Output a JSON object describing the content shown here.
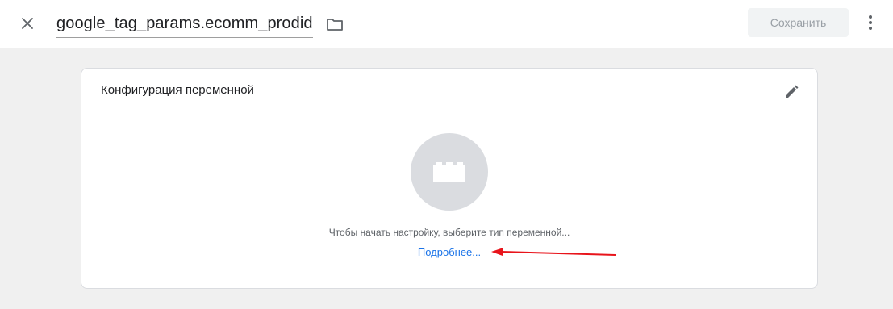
{
  "header": {
    "title": "google_tag_params.ecomm_prodid",
    "save_label": "Сохранить",
    "close_icon": "close-icon",
    "folder_icon": "folder-icon",
    "more_icon": "more-vert-icon"
  },
  "card": {
    "title": "Конфигурация переменной",
    "edit_icon": "pencil-icon",
    "placeholder_icon": "lego-brick-icon",
    "hint": "Чтобы начать настройку, выберите тип переменной...",
    "learn_more": "Подробнее..."
  },
  "colors": {
    "accent": "#1a73e8",
    "annotation_arrow": "#e8141b",
    "placeholder_bg": "#dadce0"
  }
}
